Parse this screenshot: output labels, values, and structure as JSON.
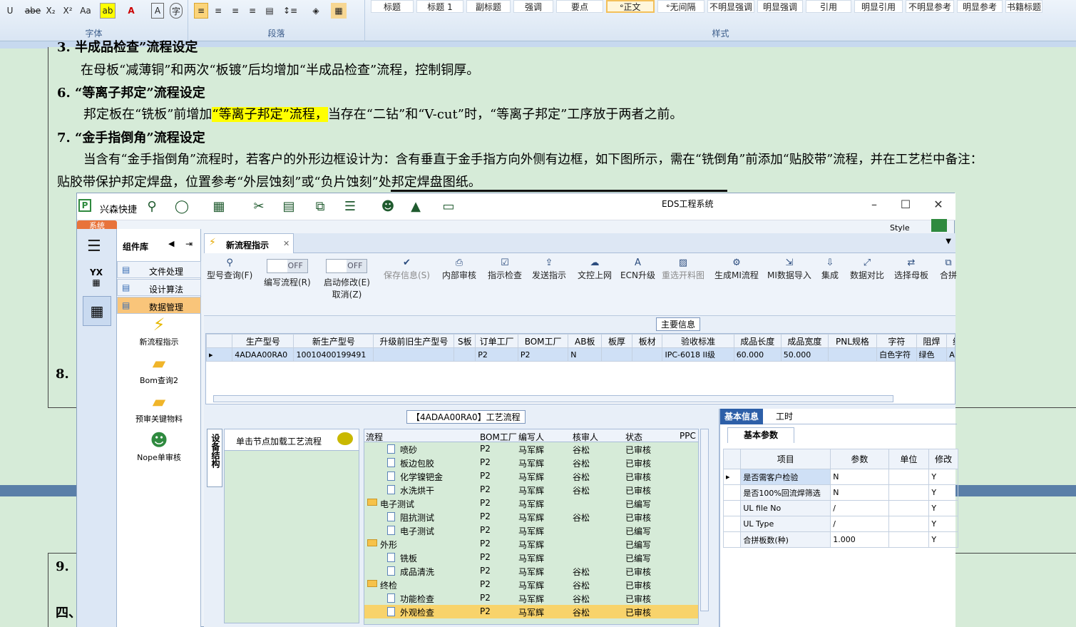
{
  "ribbon": {
    "font_group": "字体",
    "para_group": "段落",
    "styles_group": "样式",
    "font_buttons": [
      "U",
      "abe",
      "X₂",
      "X²",
      "Aa"
    ],
    "styles": [
      "标题",
      "标题 1",
      "副标题",
      "强调",
      "要点",
      "ᵉ正文",
      "ᵉ无间隔",
      "不明显强调",
      "明显强调",
      "引用",
      "明显引用",
      "不明显参考",
      "明显参考",
      "书籍标题"
    ],
    "selected_style": "ᵉ正文"
  },
  "doc": {
    "line1": "3.   半成品检查”流程设定",
    "line2": "在母板“减薄铜”和两次“板镀”后均增加“半成品检查”流程，控制铜厚。",
    "h6": "6.   “等离子邦定”流程设定",
    "p6a": "邦定板在“铣板”前增加",
    "p6hl": "“等离子邦定”流程，",
    "p6b": "当存在“二钻”和“V-cut”时，“等离子邦定”工序放于两者之前。",
    "h7": "7.   “金手指倒角”流程设定",
    "p7a": "当含有“金手指倒角”流程时，若客户的外形边框设计为：含有垂直于金手指方向外侧有边框，如下图所示，需在“铣倒角”前添加“贴胶带”流程，并在工艺栏中备注：",
    "p7b": "贴胶带保护邦定焊盘，位置参考“外层蚀刻”或“负片蚀刻”处邦定焊盘图纸。",
    "n8": "8.",
    "n9": "9.",
    "n4": "四、"
  },
  "eds": {
    "app_name": "兴森快捷",
    "window_title": "EDS工程系统",
    "system_tab": "系统",
    "style_label": "Style",
    "lib_title": "组件库",
    "lib_items": [
      "文件处理",
      "设计算法",
      "数据管理"
    ],
    "lib_selected": "数据管理",
    "launchers": [
      "新流程指示",
      "Bom查询2",
      "预审关键物料",
      "Nope单审核"
    ],
    "doc_tab": "新流程指示",
    "tools": [
      {
        "label": "型号查询(F)",
        "icon": "search-icon"
      },
      {
        "label": "编写流程(R)",
        "icon": "toggle-off"
      },
      {
        "label": "启动修改(E)",
        "sub": "取消(Z)",
        "icon": "toggle-off"
      },
      {
        "label": "保存信息(S)",
        "icon": "check-icon",
        "disabled": true
      },
      {
        "label": "内部审核",
        "icon": "printer-icon"
      },
      {
        "label": "指示检查",
        "icon": "checklist-icon"
      },
      {
        "label": "发送指示",
        "icon": "upload-icon"
      },
      {
        "label": "文控上网",
        "icon": "cloud-upload-icon"
      },
      {
        "label": "ECN升级",
        "icon": "ecn-icon"
      },
      {
        "label": "重选开料图",
        "icon": "image-icon",
        "disabled": true
      },
      {
        "label": "生成MI流程",
        "icon": "gears-icon"
      },
      {
        "label": "MI数据导入",
        "icon": "import-icon"
      },
      {
        "label": "集成",
        "icon": "download-icon"
      },
      {
        "label": "数据对比",
        "icon": "compare-icon"
      },
      {
        "label": "选择母板",
        "icon": "shuffle-icon"
      },
      {
        "label": "合拼",
        "icon": "merge-icon"
      }
    ],
    "toggle_text": "OFF",
    "main_info": "主要信息",
    "grid_headers": [
      "生产型号",
      "新生产型号",
      "升级前旧生产型号",
      "S板",
      "订单工厂",
      "BOM工厂",
      "AB板",
      "板厚",
      "板材",
      "验收标准",
      "成品长度",
      "成品宽度",
      "PNL规格",
      "字符",
      "阻焊",
      "终端"
    ],
    "grid_row": [
      "4ADAA00RA0",
      "10010400199491",
      "",
      "",
      "P2",
      "P2",
      "N",
      "",
      "",
      "IPC-6018 II级",
      "60.000",
      "50.000",
      "",
      "白色字符",
      "绿色",
      "ADAA"
    ],
    "flow_title": "【4ADAA00RA0】工艺流程",
    "side_tab": "设备结构",
    "click_hint": "单击节点加载工艺流程",
    "tree_headers": [
      "流程",
      "BOM工厂",
      "编写人",
      "核审人",
      "状态",
      "PPC"
    ],
    "tree_rows": [
      {
        "name": "喷砂",
        "lvl": 2,
        "f": "P2",
        "w": "马军辉",
        "r": "谷松",
        "s": "已审核"
      },
      {
        "name": "板边包胶",
        "lvl": 2,
        "f": "P2",
        "w": "马军辉",
        "r": "谷松",
        "s": "已审核"
      },
      {
        "name": "化学镍钯金",
        "lvl": 2,
        "f": "P2",
        "w": "马军辉",
        "r": "谷松",
        "s": "已审核"
      },
      {
        "name": "水洗烘干",
        "lvl": 2,
        "f": "P2",
        "w": "马军辉",
        "r": "谷松",
        "s": "已审核"
      },
      {
        "name": "电子测试",
        "lvl": 1,
        "f": "P2",
        "w": "马军辉",
        "r": "",
        "s": "已编写"
      },
      {
        "name": "阻抗测试",
        "lvl": 2,
        "f": "P2",
        "w": "马军辉",
        "r": "谷松",
        "s": "已审核"
      },
      {
        "name": "电子测试",
        "lvl": 2,
        "f": "P2",
        "w": "马军辉",
        "r": "",
        "s": "已编写"
      },
      {
        "name": "外形",
        "lvl": 1,
        "f": "P2",
        "w": "马军辉",
        "r": "",
        "s": "已编写"
      },
      {
        "name": "铣板",
        "lvl": 2,
        "f": "P2",
        "w": "马军辉",
        "r": "",
        "s": "已编写"
      },
      {
        "name": "成品清洗",
        "lvl": 2,
        "f": "P2",
        "w": "马军辉",
        "r": "谷松",
        "s": "已审核"
      },
      {
        "name": "终检",
        "lvl": 1,
        "f": "P2",
        "w": "马军辉",
        "r": "谷松",
        "s": "已审核"
      },
      {
        "name": "功能检查",
        "lvl": 2,
        "f": "P2",
        "w": "马军辉",
        "r": "谷松",
        "s": "已审核"
      },
      {
        "name": "外观检查",
        "lvl": 2,
        "f": "P2",
        "w": "马军辉",
        "r": "谷松",
        "s": "已审核"
      }
    ],
    "info_tabs": [
      "基本信息",
      "工时"
    ],
    "param_tab": "基本参数",
    "param_headers": [
      "项目",
      "参数",
      "单位",
      "修改"
    ],
    "params": [
      [
        "是否需客户检验",
        "N",
        "",
        "Y"
      ],
      [
        "是否100%回流焊筛选",
        "N",
        "",
        "Y"
      ],
      [
        "UL file No",
        "/",
        "",
        "Y"
      ],
      [
        "UL Type",
        "/",
        "",
        "Y"
      ],
      [
        "合拼板数(种)",
        "1.000",
        "",
        "Y"
      ]
    ]
  },
  "colors": {
    "doc_bg": "#d6ebd8",
    "highlight": "#ffff00",
    "accent": "#3b6fb5",
    "tab_active": "#2d5fa8"
  }
}
